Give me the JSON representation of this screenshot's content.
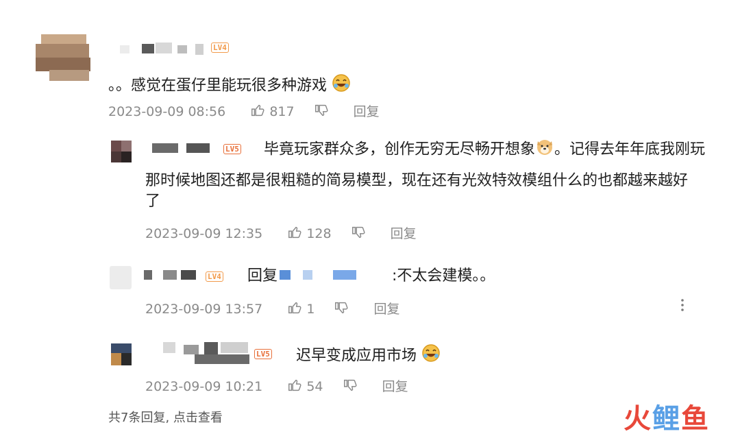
{
  "comment": {
    "level": "LV4",
    "text": "。。感觉在蛋仔里能玩很多种游戏",
    "date": "2023-09-09 08:56",
    "likes": "817",
    "reply_label": "回复"
  },
  "replies": [
    {
      "level": "LV5",
      "text_line1": "毕竟玩家群众多，创作无穷无尽畅开想象",
      "text_line1b": "。记得去年年底我刚玩",
      "text_line2": "那时候地图还都是很粗糙的简易模型，现在还有光效特效模组什么的也都越来越好",
      "text_line3": "了",
      "date": "2023-09-09 12:35",
      "likes": "128",
      "reply_label": "回复"
    },
    {
      "level": "LV4",
      "prefix": "回复",
      "text": ":不太会建模。。",
      "date": "2023-09-09 13:57",
      "likes": "1",
      "reply_label": "回复"
    },
    {
      "level": "LV5",
      "text": "迟早变成应用市场",
      "date": "2023-09-09 10:21",
      "likes": "54",
      "reply_label": "回复"
    }
  ],
  "footer": "共7条回复, 点击查看",
  "watermark": "火鲤鱼",
  "colors": {
    "accent": "#f29a4a",
    "meta": "#8a8a8a",
    "watermark_red": "#e8483a"
  },
  "icons": [
    "thumb-up-icon",
    "thumb-down-icon",
    "more-vertical-icon",
    "emoji-laugh-icon",
    "emoji-doge-icon"
  ]
}
